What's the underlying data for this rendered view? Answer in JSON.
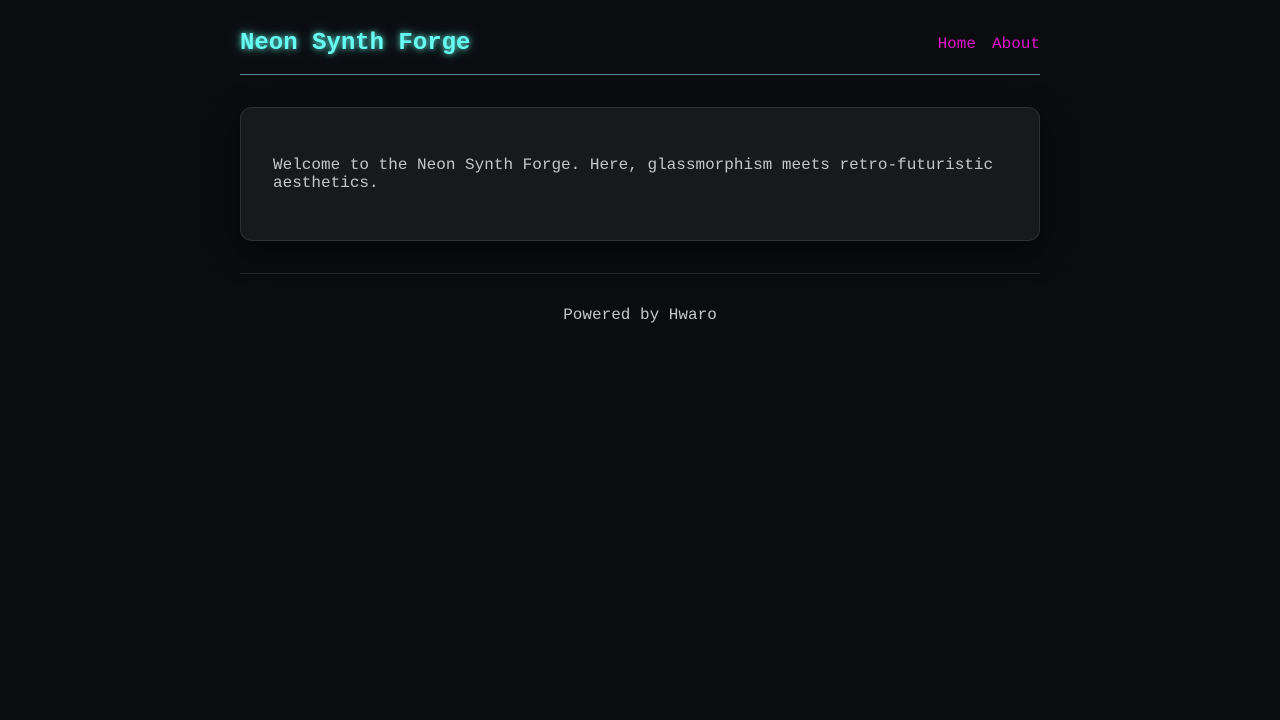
{
  "header": {
    "title": "Neon Synth Forge",
    "nav": {
      "home_label": "Home",
      "about_label": "About"
    }
  },
  "main": {
    "intro_text": "Welcome to the Neon Synth Forge. Here, glassmorphism meets retro-futuristic aesthetics."
  },
  "footer": {
    "text": "Powered by Hwaro"
  },
  "colors": {
    "background": "#0b0c10",
    "title_accent": "#66fcf1",
    "nav_link": "#e011c8",
    "card_background": "#18191d",
    "body_text": "#c5c6c7"
  }
}
